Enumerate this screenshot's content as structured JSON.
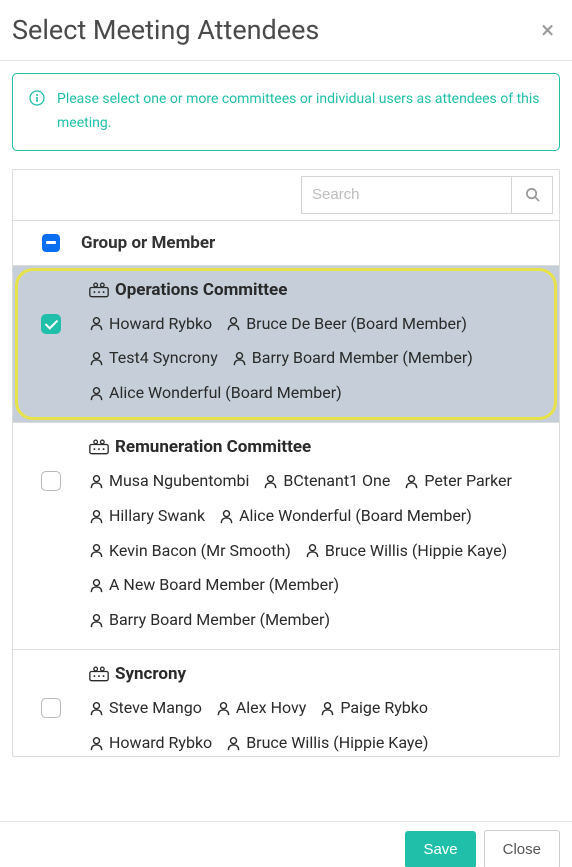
{
  "modal": {
    "title": "Select Meeting Attendees",
    "info": "Please select one or more committees or individual users as attendees of this meeting."
  },
  "search": {
    "placeholder": "Search"
  },
  "table": {
    "header": "Group or Member",
    "groups": [
      {
        "name": "Operations Committee",
        "selected": true,
        "highlighted": true,
        "members": [
          "Howard Rybko",
          "Bruce De Beer (Board Member)",
          "Test4 Syncrony",
          "Barry Board Member (Member)",
          "Alice Wonderful (Board Member)"
        ]
      },
      {
        "name": "Remuneration Committee",
        "selected": false,
        "highlighted": false,
        "members": [
          "Musa Ngubentombi",
          "BCtenant1 One",
          "Peter Parker",
          "Hillary Swank",
          "Alice Wonderful (Board Member)",
          "Kevin Bacon (Mr Smooth)",
          "Bruce Willis (Hippie Kaye)",
          "A New Board Member (Member)",
          "Barry Board Member (Member)"
        ]
      },
      {
        "name": "Syncrony",
        "selected": false,
        "highlighted": false,
        "members": [
          "Steve Mango",
          "Alex Hovy",
          "Paige Rybko",
          "Howard Rybko",
          "Bruce Willis (Hippie Kaye)"
        ]
      }
    ]
  },
  "footer": {
    "save": "Save",
    "close": "Close"
  }
}
